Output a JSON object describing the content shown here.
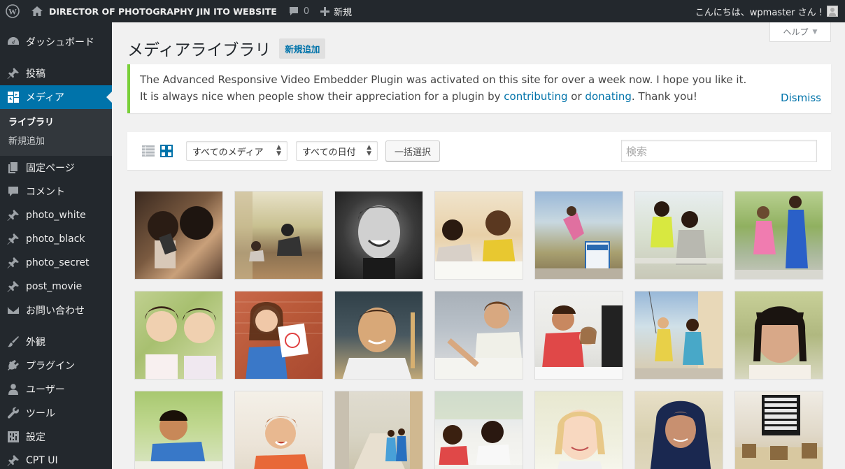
{
  "adminbar": {
    "site_name": "DIRECTOR OF PHOTOGRAPHY JIN ITO WEBSITE",
    "comments_count": "0",
    "new_label": "新規",
    "greeting": "こんにちは、wpmaster さん !"
  },
  "sidebar": {
    "items": [
      {
        "label": "ダッシュボード",
        "icon": "dashboard-icon"
      },
      {
        "label": "投稿",
        "icon": "pin-icon"
      },
      {
        "label": "メディア",
        "icon": "media-icon"
      },
      {
        "label": "固定ページ",
        "icon": "page-icon"
      },
      {
        "label": "コメント",
        "icon": "comment-icon"
      },
      {
        "label": "photo_white",
        "icon": "pin-icon"
      },
      {
        "label": "photo_black",
        "icon": "pin-icon"
      },
      {
        "label": "photo_secret",
        "icon": "pin-icon"
      },
      {
        "label": "post_movie",
        "icon": "pin-icon"
      },
      {
        "label": "お問い合わせ",
        "icon": "mail-icon"
      },
      {
        "label": "外観",
        "icon": "brush-icon"
      },
      {
        "label": "プラグイン",
        "icon": "plugin-icon"
      },
      {
        "label": "ユーザー",
        "icon": "user-icon"
      },
      {
        "label": "ツール",
        "icon": "wrench-icon"
      },
      {
        "label": "設定",
        "icon": "settings-icon"
      },
      {
        "label": "CPT UI",
        "icon": "pin-icon"
      }
    ],
    "media_submenu": [
      "ライブラリ",
      "新規追加"
    ]
  },
  "help_tab": "ヘルプ",
  "page": {
    "title": "メディアライブラリ",
    "add_new": "新規追加"
  },
  "notice": {
    "line1": "The Advanced Responsive Video Embedder Plugin was activated on this site for over a week now. I hope you like it.",
    "line2_pre": "It is always nice when people show their appreciation for a plugin by ",
    "link1": "contributing",
    "or": " or ",
    "link2": "donating",
    "line2_post": ". Thank you!",
    "dismiss": "Dismiss"
  },
  "toolbar": {
    "filter_type": "すべてのメディア",
    "filter_date": "すべての日付",
    "bulk_select": "一括選択",
    "search_placeholder": "検索"
  },
  "colors": {
    "adminbar": "#23282d",
    "active_menu": "#0073aa",
    "notice_border": "#7ad03a",
    "link": "#0073aa"
  }
}
